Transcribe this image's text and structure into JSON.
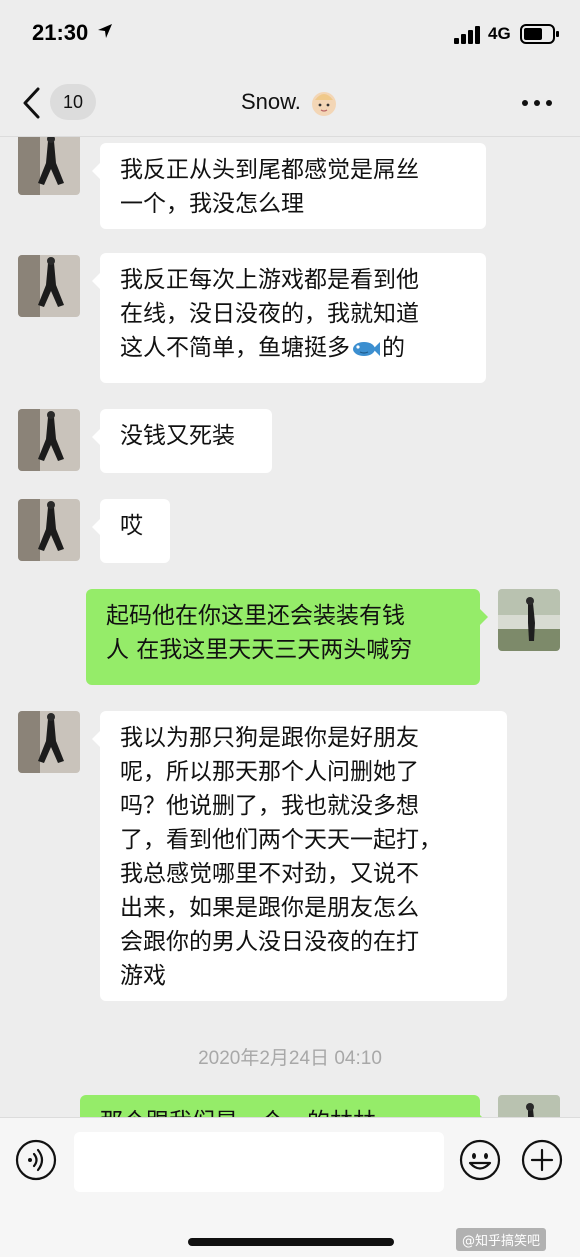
{
  "status_bar": {
    "time": "21:30",
    "network": "4G"
  },
  "header": {
    "back_count": "10",
    "title": "Snow.",
    "more_icon": "more-dots-icon"
  },
  "messages": [
    {
      "side": "left",
      "text_lines": [
        "我反正从头到尾都感觉是屌丝",
        "一个，我没怎么理"
      ]
    },
    {
      "side": "left",
      "text_lines": [
        "我反正每次上游戏都是看到他",
        "在线，没日没夜的，我就知道",
        "这人不简单，鱼塘挺多",
        "的"
      ]
    },
    {
      "side": "left",
      "text_lines": [
        "没钱又死装"
      ]
    },
    {
      "side": "left",
      "text_lines": [
        "哎"
      ]
    },
    {
      "side": "right",
      "text_lines": [
        "起码他在你这里还会装装有钱",
        "人 在我这里天天三天两头喊穷"
      ]
    },
    {
      "side": "left",
      "text_lines": [
        "我以为那只狗是跟你是好朋友",
        "呢，所以那天那个人问删她了",
        "吗？他说删了，我也就没多想",
        "了，看到他们两个天天一起打，",
        "我总感觉哪里不对劲，又说不",
        "出来，如果是跟你是朋友怎么",
        "会跟你的男人没日没夜的在打",
        "游戏"
      ]
    },
    {
      "side": "right",
      "text_lines": [
        "那个跟我们是一个…的林林"
      ]
    }
  ],
  "timestamp": "2020年2月24日 04:10",
  "input_bar": {
    "placeholder": "",
    "voice_icon": "voice-icon",
    "emoji_icon": "emoji-icon",
    "plus_icon": "plus-icon"
  },
  "watermark": "@知乎搞笑吧",
  "colors": {
    "background": "#ededed",
    "bubble_self": "#95ec69",
    "bubble_other": "#ffffff",
    "timestamp": "#a8a8a8"
  }
}
